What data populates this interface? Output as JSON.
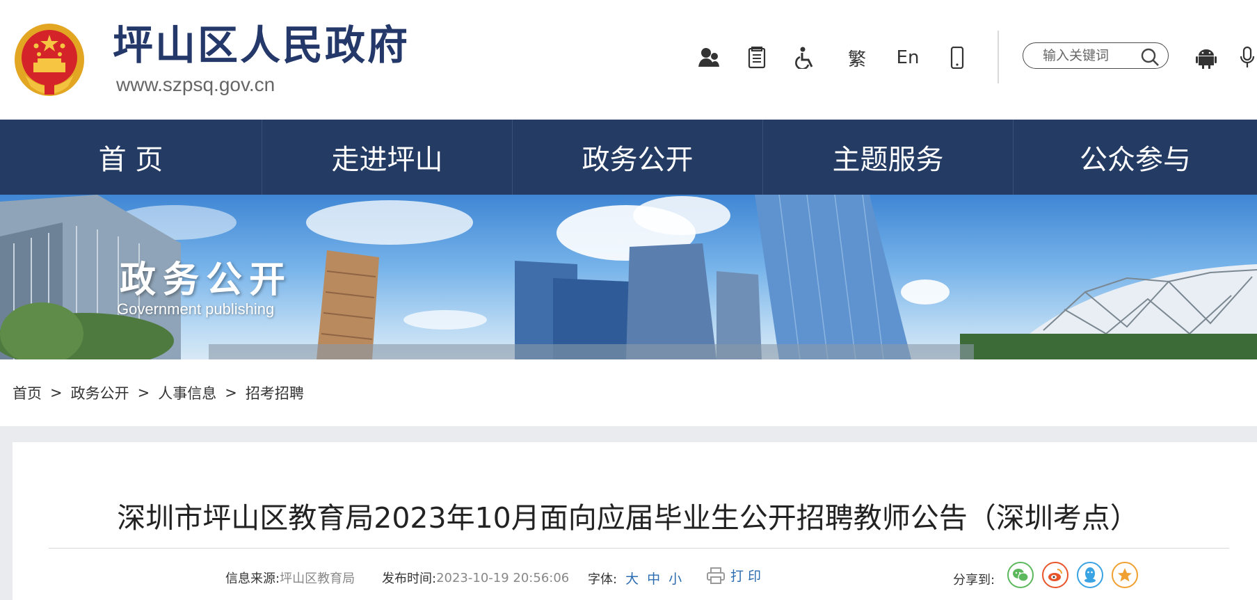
{
  "header": {
    "site_title": "坪山区人民政府",
    "site_url": "www.szpsq.gov.cn",
    "tools": {
      "traditional": "繁",
      "english": "En"
    },
    "search": {
      "placeholder": "输入关键词"
    }
  },
  "nav": {
    "items": [
      {
        "label": "首 页"
      },
      {
        "label": "走进坪山"
      },
      {
        "label": "政务公开"
      },
      {
        "label": "主题服务"
      },
      {
        "label": "公众参与"
      }
    ]
  },
  "banner": {
    "title": "政务公开",
    "subtitle": "Government publishing"
  },
  "breadcrumb": {
    "items": [
      "首页",
      "政务公开",
      "人事信息",
      "招考招聘"
    ],
    "separator": ">"
  },
  "article": {
    "title": "深圳市坪山区教育局2023年10月面向应届毕业生公开招聘教师公告（深圳考点）",
    "source_label": "信息来源:",
    "source_value": "坪山区教育局",
    "date_label": "发布时间:",
    "date_value": "2023-10-19 20:56:06",
    "font_label": "字体:",
    "font_sizes": [
      "大",
      "中",
      "小"
    ],
    "print_label": "打 印",
    "share_label": "分享到:"
  },
  "colors": {
    "nav_bg": "#243b63",
    "title_blue": "#24396a",
    "link_blue": "#2b6cb0",
    "wechat": "#5cb85c",
    "weibo": "#e8552b",
    "qq": "#3aa3e3",
    "favorite": "#f0a030"
  },
  "icons": [
    "emblem-icon",
    "user-group-icon",
    "document-icon",
    "accessibility-icon",
    "mobile-icon",
    "search-icon",
    "android-icon",
    "voice-icon",
    "printer-icon",
    "wechat-icon",
    "weibo-icon",
    "qq-icon",
    "star-icon"
  ]
}
